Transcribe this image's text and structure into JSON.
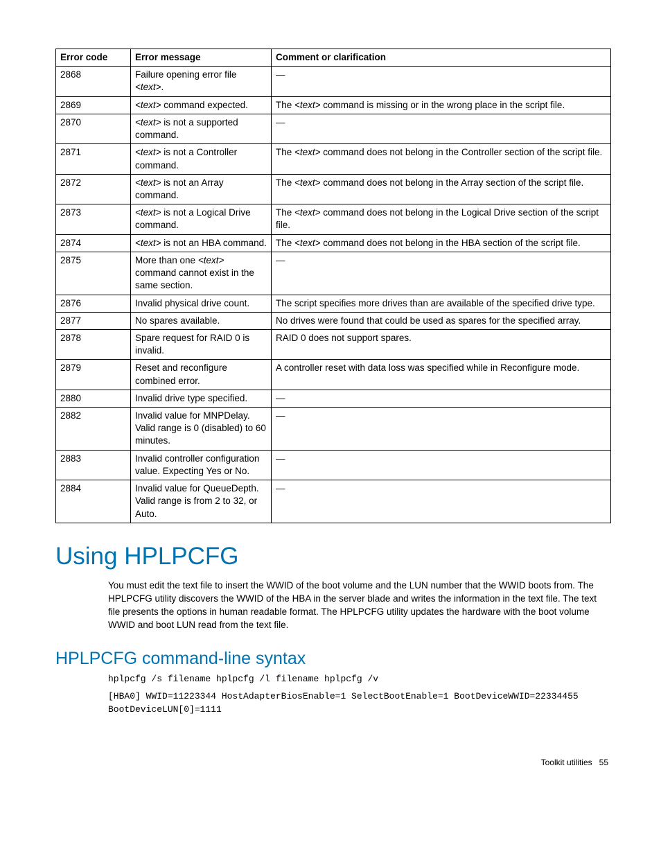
{
  "table": {
    "headers": [
      "Error code",
      "Error message",
      "Comment or clarification"
    ],
    "rows": [
      {
        "code": "2868",
        "msg_pre": "Failure opening error file ",
        "msg_it": "<text>",
        "msg_post": ".",
        "cmt_pre": "—",
        "cmt_it": "",
        "cmt_post": ""
      },
      {
        "code": "2869",
        "msg_pre": "",
        "msg_it": "<text>",
        "msg_post": " command expected.",
        "cmt_pre": "The ",
        "cmt_it": "<text>",
        "cmt_post": " command is missing or in the wrong place in the script file."
      },
      {
        "code": "2870",
        "msg_pre": "",
        "msg_it": "<text>",
        "msg_post": " is not a supported command.",
        "cmt_pre": "—",
        "cmt_it": "",
        "cmt_post": ""
      },
      {
        "code": "2871",
        "msg_pre": "",
        "msg_it": "<text>",
        "msg_post": " is not a Controller command.",
        "cmt_pre": "The ",
        "cmt_it": "<text>",
        "cmt_post": " command does not belong in the Controller section of the script file."
      },
      {
        "code": "2872",
        "msg_pre": "",
        "msg_it": "<text>",
        "msg_post": " is not an Array command.",
        "cmt_pre": "The ",
        "cmt_it": "<text>",
        "cmt_post": " command does not belong in the Array section of the script file."
      },
      {
        "code": "2873",
        "msg_pre": "",
        "msg_it": "<text>",
        "msg_post": " is not a Logical Drive command.",
        "cmt_pre": "The ",
        "cmt_it": "<text>",
        "cmt_post": " command does not belong in the Logical Drive section of the script file."
      },
      {
        "code": "2874",
        "msg_pre": "",
        "msg_it": "<text>",
        "msg_post": " is not an HBA command.",
        "cmt_pre": "The ",
        "cmt_it": "<text>",
        "cmt_post": " command does not belong in the HBA section of the script file."
      },
      {
        "code": "2875",
        "msg_pre": "More than one ",
        "msg_it": "<text>",
        "msg_post": " command cannot exist in the same section.",
        "cmt_pre": "—",
        "cmt_it": "",
        "cmt_post": ""
      },
      {
        "code": "2876",
        "msg_pre": "Invalid physical drive count.",
        "msg_it": "",
        "msg_post": "",
        "cmt_pre": "The script specifies more drives than are available of the specified drive type.",
        "cmt_it": "",
        "cmt_post": ""
      },
      {
        "code": "2877",
        "msg_pre": "No spares available.",
        "msg_it": "",
        "msg_post": "",
        "cmt_pre": "No drives were found that could be used as spares for the specified array.",
        "cmt_it": "",
        "cmt_post": ""
      },
      {
        "code": "2878",
        "msg_pre": "Spare request for RAID 0 is invalid.",
        "msg_it": "",
        "msg_post": "",
        "cmt_pre": "RAID 0 does not support spares.",
        "cmt_it": "",
        "cmt_post": ""
      },
      {
        "code": "2879",
        "msg_pre": "Reset and reconfigure combined error.",
        "msg_it": "",
        "msg_post": "",
        "cmt_pre": "A controller reset with data loss was specified while in Reconfigure mode.",
        "cmt_it": "",
        "cmt_post": ""
      },
      {
        "code": "2880",
        "msg_pre": "Invalid drive type specified.",
        "msg_it": "",
        "msg_post": "",
        "cmt_pre": "—",
        "cmt_it": "",
        "cmt_post": ""
      },
      {
        "code": "2882",
        "msg_pre": "Invalid value for MNPDelay. Valid range is 0 (disabled) to 60 minutes.",
        "msg_it": "",
        "msg_post": "",
        "cmt_pre": "—",
        "cmt_it": "",
        "cmt_post": ""
      },
      {
        "code": "2883",
        "msg_pre": "Invalid controller configuration value. Expecting Yes or No.",
        "msg_it": "",
        "msg_post": "",
        "cmt_pre": "—",
        "cmt_it": "",
        "cmt_post": ""
      },
      {
        "code": "2884",
        "msg_pre": "Invalid value for QueueDepth. Valid range is from 2 to 32, or Auto.",
        "msg_it": "",
        "msg_post": "",
        "cmt_pre": "—",
        "cmt_it": "",
        "cmt_post": ""
      }
    ]
  },
  "section1": {
    "heading": "Using HPLPCFG",
    "body": "You must edit the text file to insert the WWID of the boot volume and the LUN number that the WWID boots from. The HPLPCFG utility discovers the WWID of the HBA in the server blade and writes the information in the text file. The text file presents the options in human readable format. The HPLPCFG utility updates the hardware with the boot volume WWID and boot LUN read from the text file."
  },
  "section2": {
    "heading": "HPLPCFG command-line syntax",
    "code1": "hplpcfg /s filename hplpcfg /l filename hplpcfg /v",
    "code2": "[HBA0] WWID=11223344 HostAdapterBiosEnable=1 SelectBootEnable=1 BootDeviceWWID=22334455 BootDeviceLUN[0]=1111"
  },
  "footer": {
    "label": "Toolkit utilities",
    "page": "55"
  }
}
